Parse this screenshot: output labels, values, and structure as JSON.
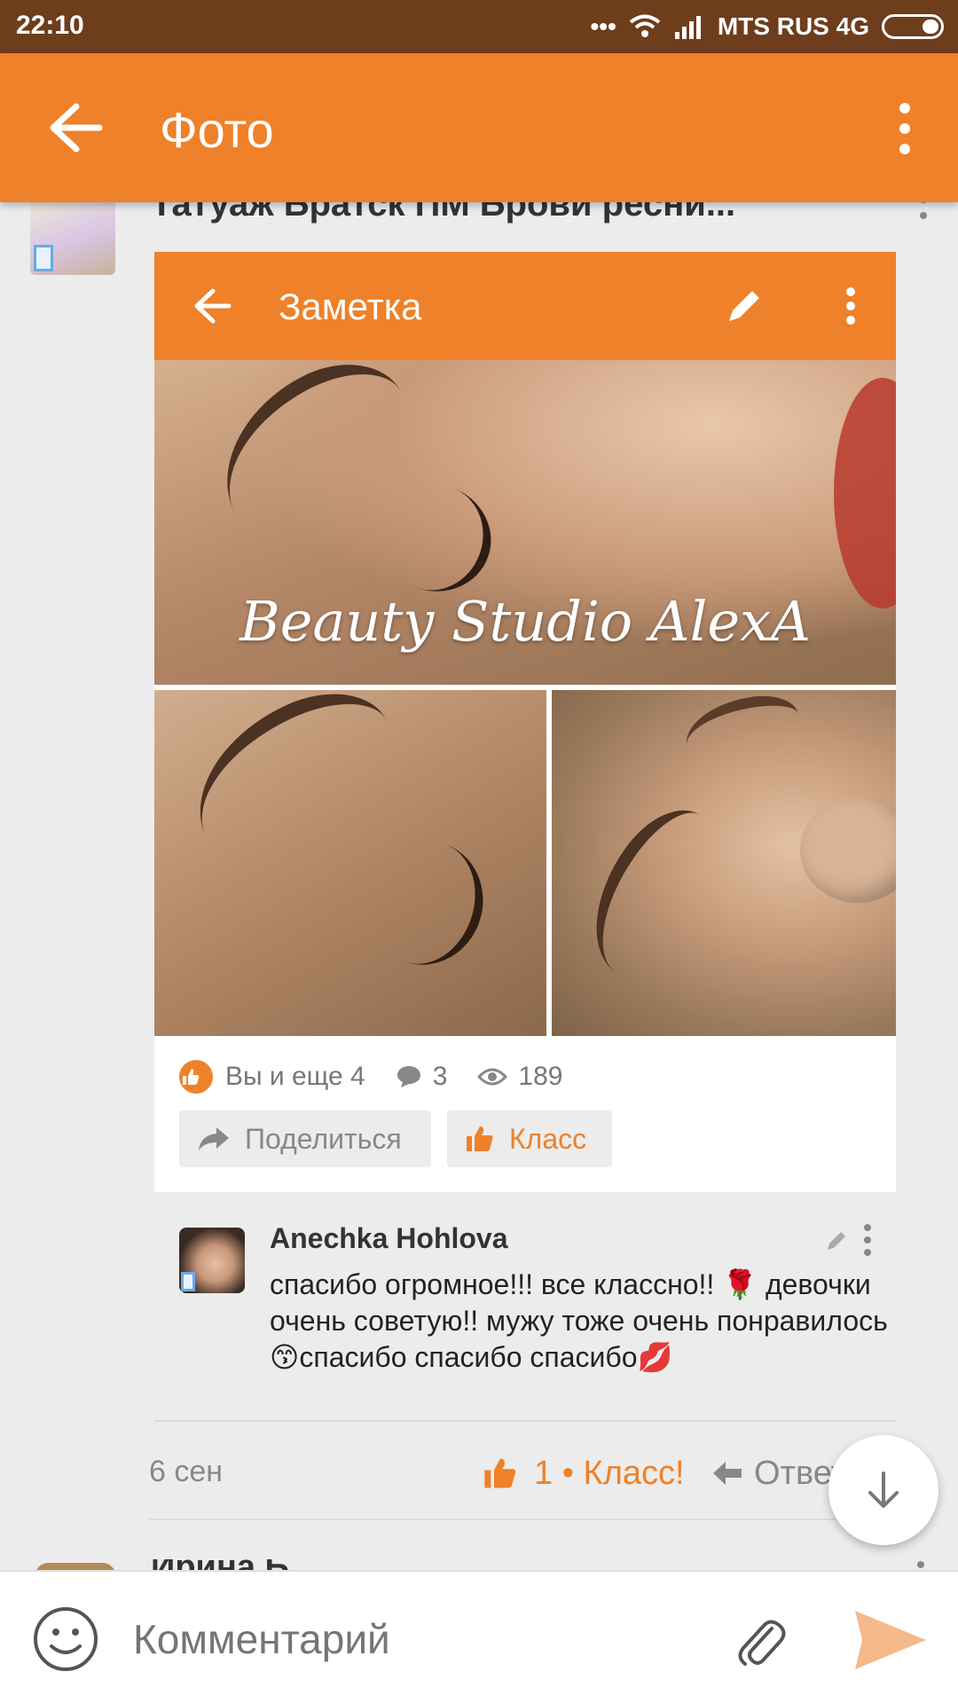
{
  "status_bar": {
    "time": "22:10",
    "carrier": "MTS RUS 4G",
    "dots": "•••"
  },
  "app_bar": {
    "title": "Фото"
  },
  "group": {
    "title": "Татуаж Братск ПМ Брови ресни..."
  },
  "note_screen": {
    "title": "Заметка",
    "photo_caption": "Beauty Studio AlexA",
    "likes_text": "Вы и еще 4",
    "comments_count": "3",
    "views_count": "189",
    "share_label": "Поделиться",
    "klass_label": "Класс"
  },
  "comment": {
    "author": "Anechka Hohlova",
    "text": "спасибо огромное!!! все классно!! 🌹 девочки очень советую!! мужу тоже очень понравилось😙спасибо спасибо спасибо💋",
    "date": "6 сен",
    "likes": "1 • Класс!",
    "reply_label": "Ответить"
  },
  "next_comment": {
    "author_partial": "Ирина Б"
  },
  "composer": {
    "placeholder": "Комментарий"
  },
  "colors": {
    "accent": "#ee8129",
    "status_bar": "#6e3d1c",
    "background": "#ececec"
  }
}
